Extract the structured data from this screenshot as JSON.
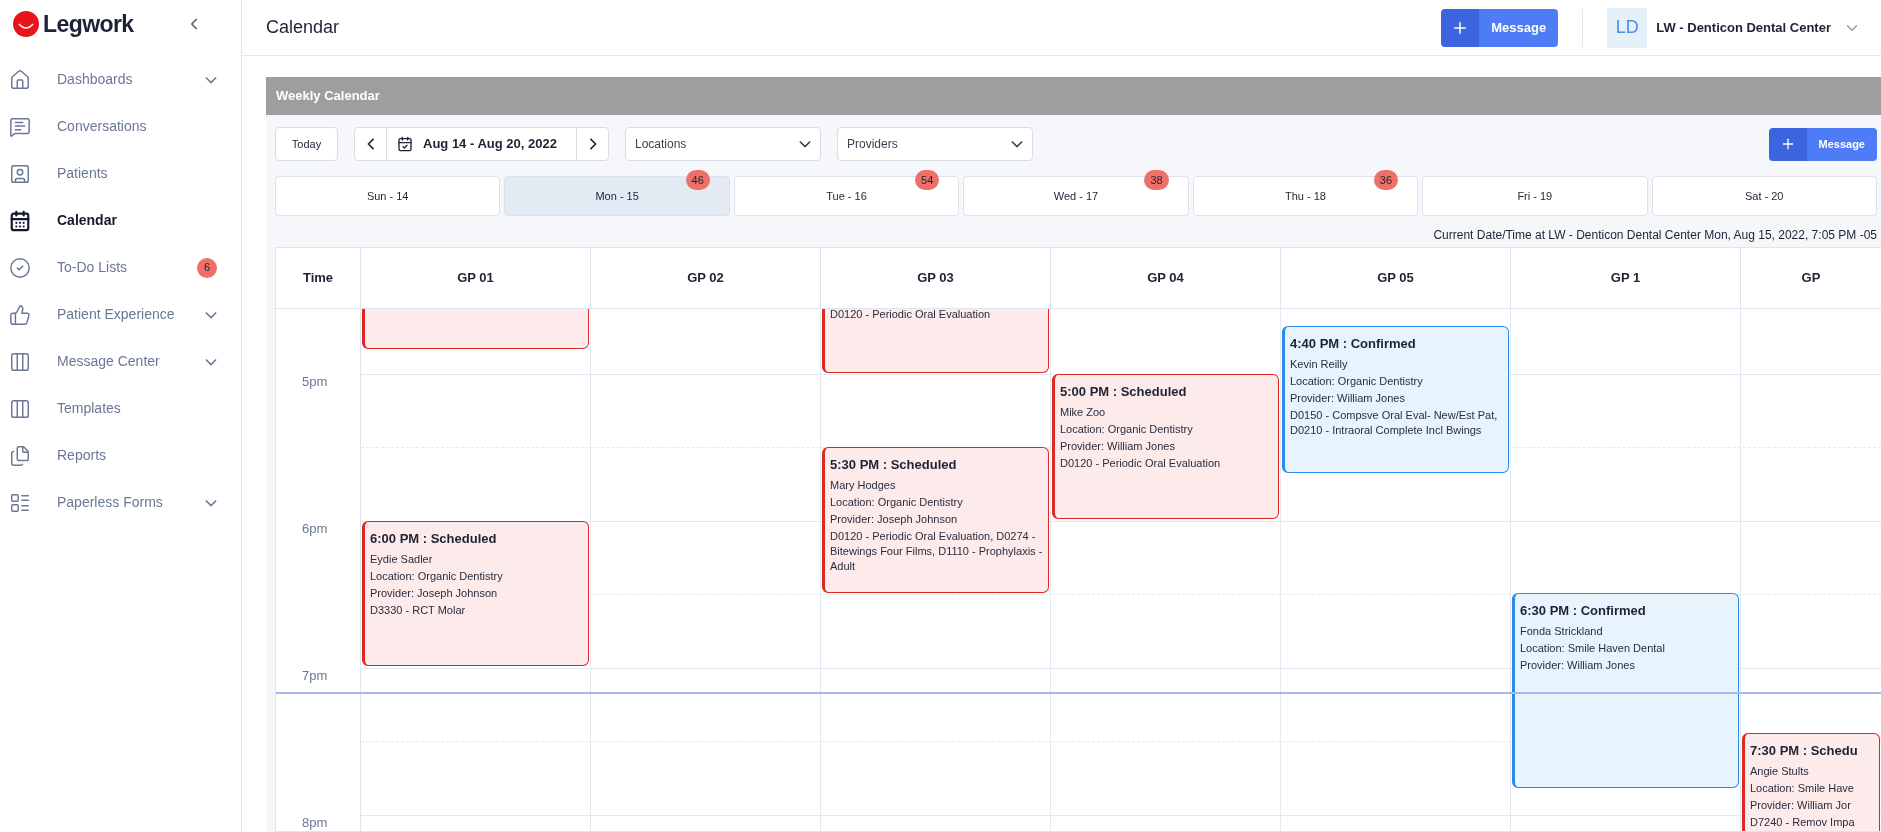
{
  "brand": {
    "name": "Legwork"
  },
  "sidebar": {
    "items": [
      {
        "label": "Dashboards",
        "selected": false,
        "has_submenu": true
      },
      {
        "label": "Conversations",
        "selected": false,
        "has_submenu": false
      },
      {
        "label": "Patients",
        "selected": false,
        "has_submenu": false
      },
      {
        "label": "Calendar",
        "selected": true,
        "has_submenu": false
      },
      {
        "label": "To-Do Lists",
        "selected": false,
        "has_submenu": false,
        "badge": "6"
      },
      {
        "label": "Patient Experience",
        "selected": false,
        "has_submenu": true
      },
      {
        "label": "Message Center",
        "selected": false,
        "has_submenu": true
      },
      {
        "label": "Templates",
        "selected": false,
        "has_submenu": false
      },
      {
        "label": "Reports",
        "selected": false,
        "has_submenu": false
      },
      {
        "label": "Paperless Forms",
        "selected": false,
        "has_submenu": true
      }
    ]
  },
  "header": {
    "title": "Calendar",
    "message_button": "Message",
    "account": {
      "initials": "LD",
      "name": "LW - Denticon Dental Center"
    }
  },
  "panel": {
    "title": "Weekly Calendar",
    "toolbar": {
      "today": "Today",
      "date_range": "Aug 14 - Aug 20, 2022",
      "locations": {
        "placeholder": "Locations"
      },
      "providers": {
        "placeholder": "Providers"
      },
      "message_button": "Message"
    },
    "days": [
      {
        "label": "Sun - 14",
        "selected": false
      },
      {
        "label": "Mon - 15",
        "selected": true,
        "badge": "46"
      },
      {
        "label": "Tue - 16",
        "selected": false,
        "badge": "54"
      },
      {
        "label": "Wed - 17",
        "selected": false,
        "badge": "38"
      },
      {
        "label": "Thu - 18",
        "selected": false,
        "badge": "36"
      },
      {
        "label": "Fri - 19",
        "selected": false
      },
      {
        "label": "Sat - 20",
        "selected": false
      }
    ],
    "current_datetime": "Current Date/Time at LW - Denticon Dental Center Mon, Aug 15, 2022, 7:05 PM -05",
    "grid": {
      "time_heading": "Time",
      "time_labels": [
        "5pm",
        "6pm",
        "7pm",
        "8pm"
      ],
      "columns": [
        {
          "label": "GP 01",
          "events": [
            {
              "kind": "scheduled"
            },
            {
              "kind": "scheduled",
              "title": "6:00 PM : Scheduled",
              "lines": [
                "Eydie Sadler",
                "Location: Organic Dentistry",
                "Provider: Joseph Johnson",
                "D3330 - RCT Molar"
              ]
            }
          ]
        },
        {
          "label": "GP 02"
        },
        {
          "label": "GP 03",
          "events": [
            {
              "kind": "scheduled",
              "lines": [
                "D0120 - Periodic Oral Evaluation"
              ]
            },
            {
              "kind": "scheduled",
              "title": "5:30 PM : Scheduled",
              "lines": [
                "Mary Hodges",
                "Location: Organic Dentistry",
                "Provider: Joseph Johnson",
                "D0120 - Periodic Oral Evaluation, D0274 - Bitewings Four Films, D1110 - Prophylaxis - Adult"
              ]
            }
          ]
        },
        {
          "label": "GP 04",
          "events": [
            {
              "kind": "scheduled",
              "title": "5:00 PM : Scheduled",
              "lines": [
                "Mike Zoo",
                "Location: Organic Dentistry",
                "Provider: William Jones",
                "D0120 - Periodic Oral Evaluation"
              ]
            }
          ]
        },
        {
          "label": "GP 05",
          "events": [
            {
              "kind": "confirmed",
              "title": "4:40 PM : Confirmed",
              "lines": [
                "Kevin Reilly",
                "Location: Organic Dentistry",
                "Provider: William Jones",
                "D0150 - Compsve Oral Eval- New/Est Pat, D0210 - Intraoral Complete Incl Bwings"
              ]
            }
          ]
        },
        {
          "label": "GP 1",
          "events": [
            {
              "kind": "confirmed",
              "title": "6:30 PM : Confirmed",
              "lines": [
                "Fonda Strickland",
                "Location: Smile Haven Dental",
                "Provider: William Jones"
              ]
            }
          ]
        },
        {
          "label": "GP",
          "events": [
            {
              "kind": "scheduled",
              "title": "7:30 PM : Schedu",
              "lines": [
                "Angie Stults",
                "Location: Smile Have",
                "Provider: William Jor",
                "D7240 - Remov Impa"
              ]
            }
          ]
        }
      ]
    }
  }
}
